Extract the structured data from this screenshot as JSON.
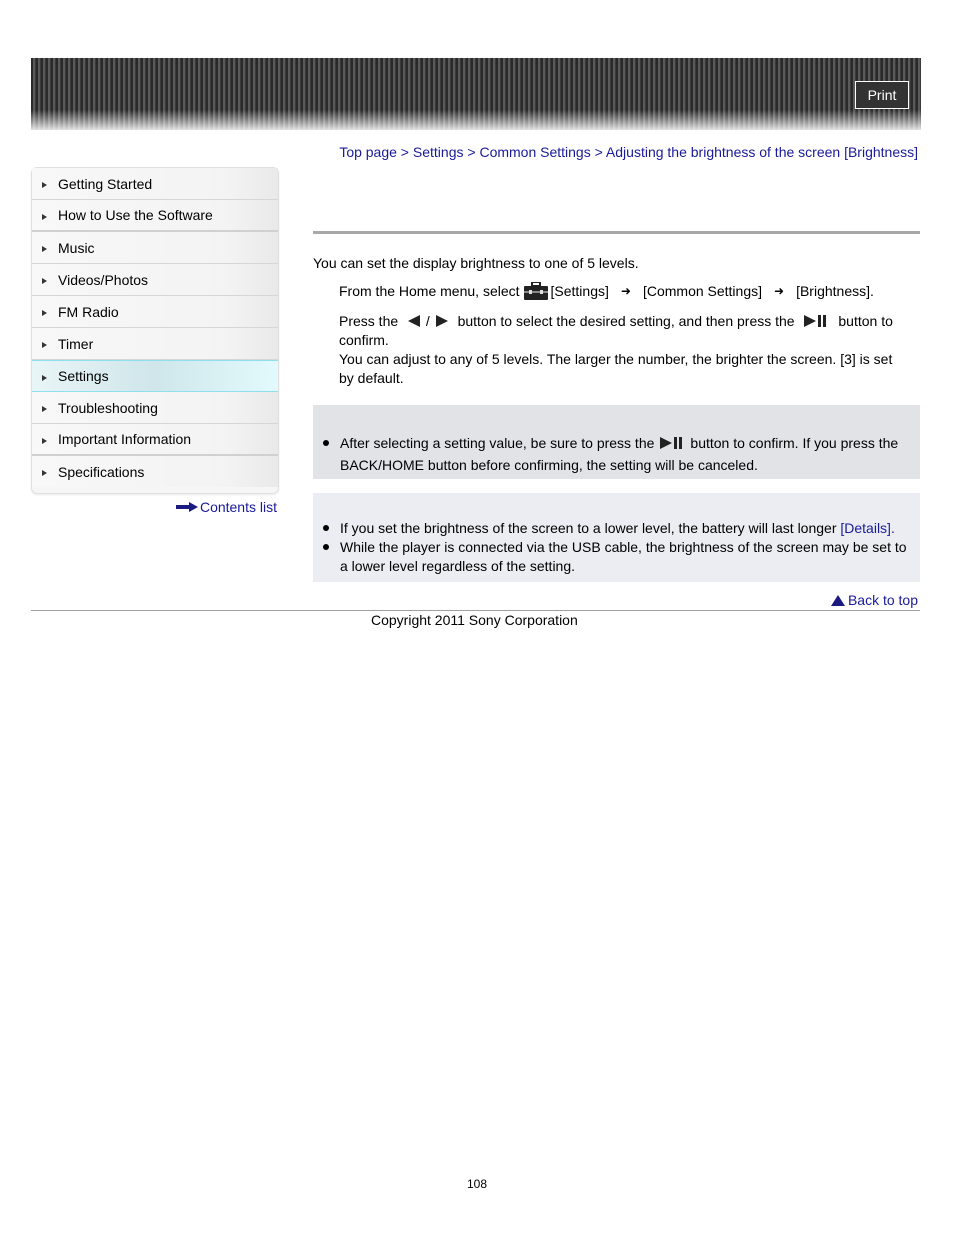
{
  "header": {
    "print_label": "Print"
  },
  "breadcrumb": [
    {
      "label": "Top page"
    },
    {
      "label": "Settings"
    },
    {
      "label": "Common Settings"
    },
    {
      "label": "Adjusting the brightness of the screen [Brightness]"
    }
  ],
  "breadcrumb_separator": " > ",
  "sidebar": {
    "items": [
      {
        "label": "Getting Started"
      },
      {
        "label": "How to Use the Software"
      },
      {
        "label": "Music"
      },
      {
        "label": "Videos/Photos"
      },
      {
        "label": "FM Radio"
      },
      {
        "label": "Timer"
      },
      {
        "label": "Settings",
        "active": true
      },
      {
        "label": "Troubleshooting"
      },
      {
        "label": "Important Information"
      },
      {
        "label": "Specifications"
      }
    ],
    "contents_list": "Contents list"
  },
  "main": {
    "intro": "You can set the display brightness to one of 5 levels.",
    "step1": {
      "prefix": "From the Home menu, select",
      "settings": "[Settings]",
      "common": "[Common Settings]",
      "brightness": "[Brightness]."
    },
    "step2": {
      "part1": "Press the",
      "slash": "/",
      "part2": "button to select the desired setting, and then press the",
      "part3": "button to confirm.",
      "line2": "You can adjust to any of 5 levels. The larger the number, the brighter the screen. [3] is set by default."
    },
    "note": {
      "part1": "After selecting a setting value, be sure to press the",
      "part2": "button to confirm. If you press the BACK/HOME button before confirming, the setting will be canceled."
    },
    "hints": {
      "item1": "If you set the brightness of the screen to a lower level, the battery will last longer",
      "item1_link": "[Details]",
      "item1_end": ".",
      "item2": "While the player is connected via the USB cable, the brightness of the screen may be set to a lower level regardless of the setting."
    },
    "back_to_top": "Back to top"
  },
  "footer": {
    "copyright": "Copyright 2011 Sony Corporation",
    "page_number": "108"
  },
  "colors": {
    "link": "#1a1a99",
    "active_nav_border": "#8fe0ee",
    "note_bg": "#e1e3e7",
    "hint_bg": "#ebedf2"
  }
}
